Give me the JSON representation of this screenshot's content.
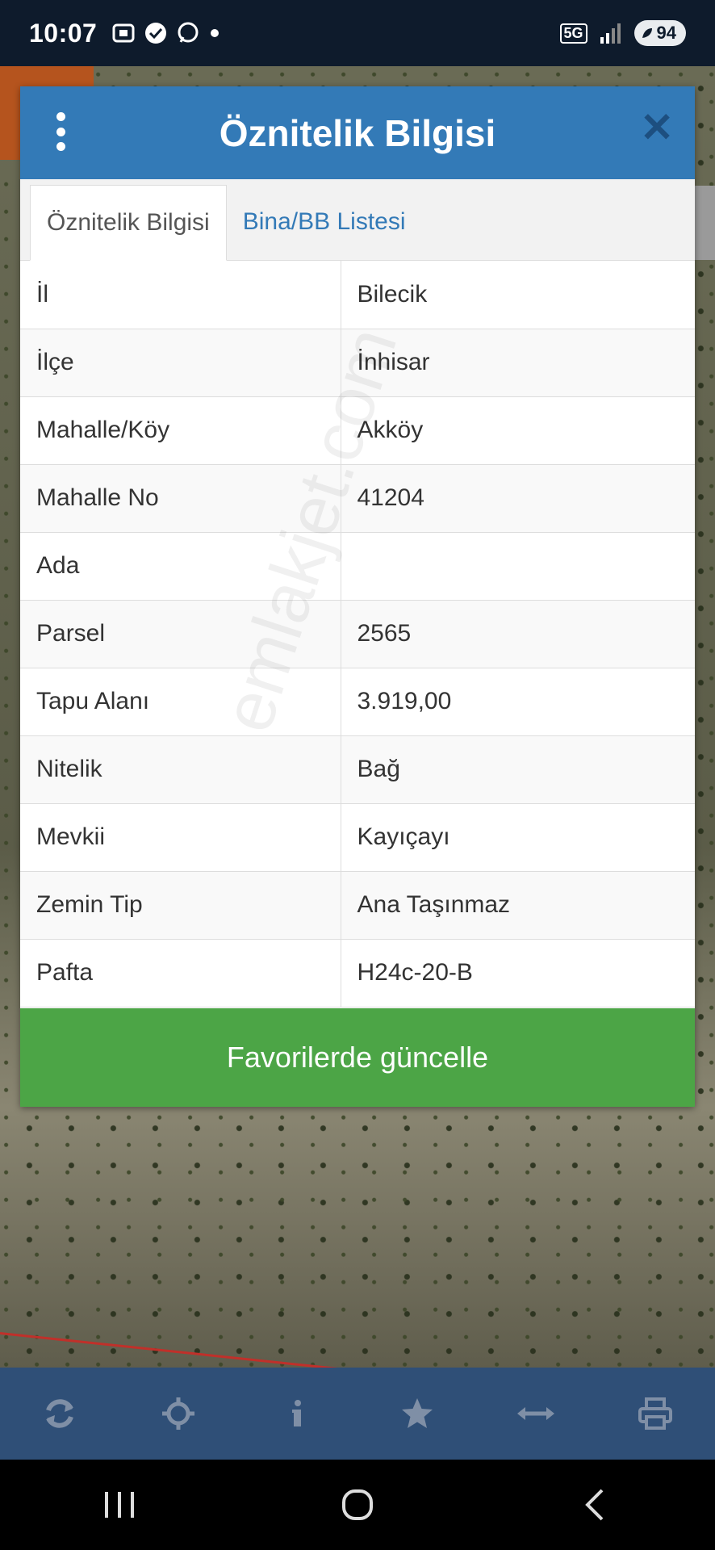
{
  "status_bar": {
    "time": "10:07",
    "network": "5G",
    "battery": "94"
  },
  "dialog": {
    "title": "Öznitelik Bilgisi",
    "tabs": [
      {
        "label": "Öznitelik Bilgisi",
        "active": true
      },
      {
        "label": "Bina/BB Listesi",
        "active": false
      }
    ],
    "rows": [
      {
        "key": "İl",
        "value": "Bilecik"
      },
      {
        "key": "İlçe",
        "value": "İnhisar"
      },
      {
        "key": "Mahalle/Köy",
        "value": "Akköy"
      },
      {
        "key": "Mahalle No",
        "value": "41204"
      },
      {
        "key": "Ada",
        "value": ""
      },
      {
        "key": "Parsel",
        "value": "2565"
      },
      {
        "key": "Tapu Alanı",
        "value": "3.919,00"
      },
      {
        "key": "Nitelik",
        "value": "Bağ"
      },
      {
        "key": "Mevkii",
        "value": "Kayıçayı"
      },
      {
        "key": "Zemin Tip",
        "value": "Ana Taşınmaz"
      },
      {
        "key": "Pafta",
        "value": "H24c-20-B"
      }
    ],
    "action_label": "Favorilerde güncelle",
    "watermark": "emlakjet.com"
  },
  "toolbar": {
    "icons": [
      "refresh-icon",
      "crosshair-icon",
      "info-icon",
      "star-icon",
      "measure-arrows-icon",
      "print-icon"
    ]
  },
  "colors": {
    "header": "#337ab7",
    "action": "#4ca546",
    "toolbar": "#2f4f77"
  }
}
